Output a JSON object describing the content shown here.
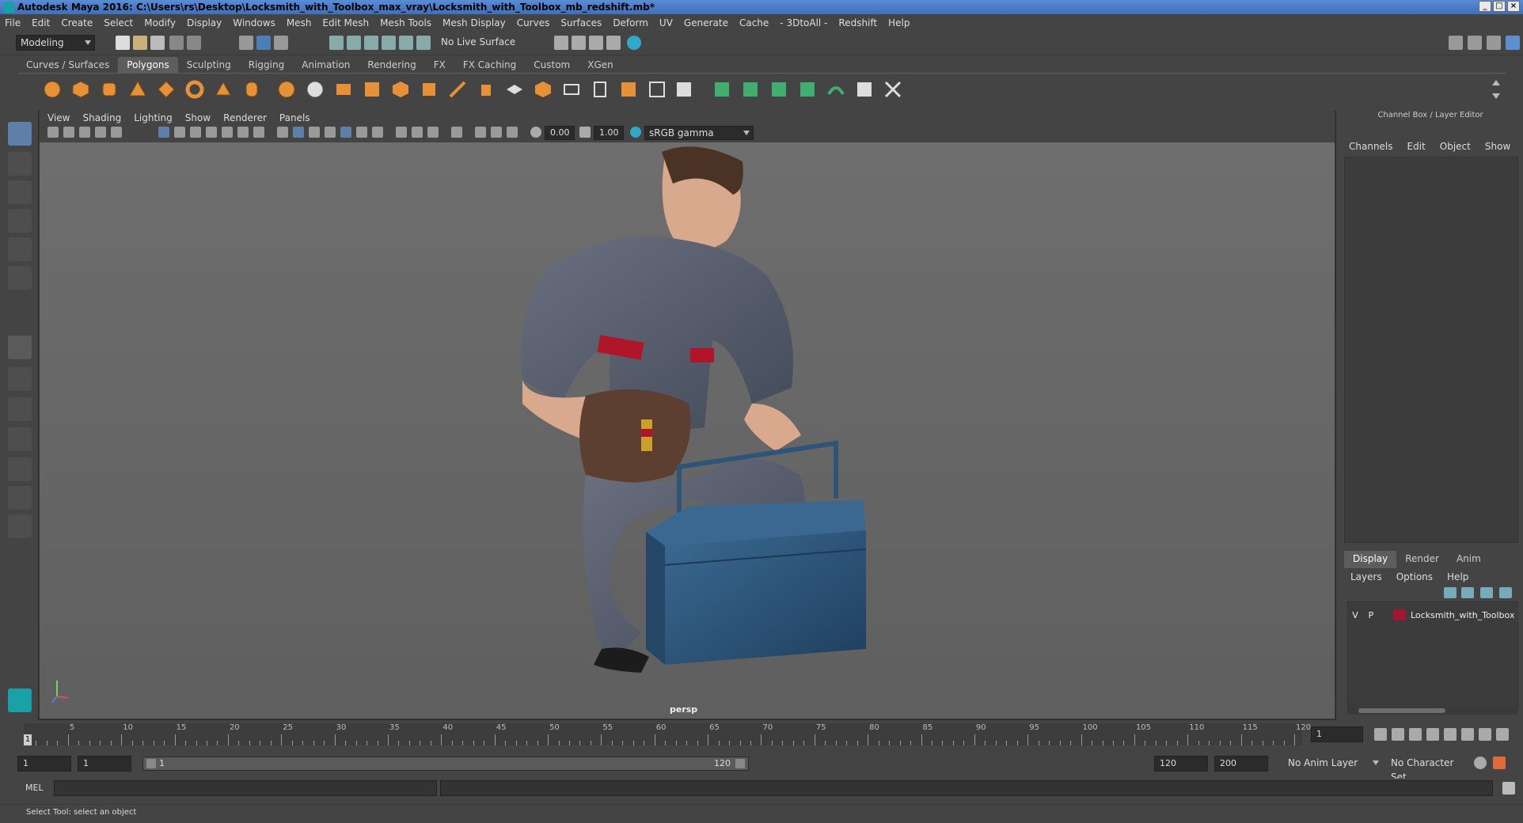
{
  "window": {
    "title": "Autodesk Maya 2016: C:\\Users\\rs\\Desktop\\Locksmith_with_Toolbox_max_vray\\Locksmith_with_Toolbox_mb_redshift.mb*",
    "buttons": [
      "_",
      "□",
      "×"
    ]
  },
  "menubar": [
    "File",
    "Edit",
    "Create",
    "Select",
    "Modify",
    "Display",
    "Windows",
    "Mesh",
    "Edit Mesh",
    "Mesh Tools",
    "Mesh Display",
    "Curves",
    "Surfaces",
    "Deform",
    "UV",
    "Generate",
    "Cache",
    "- 3DtoAll -",
    "Redshift",
    "Help"
  ],
  "toolbar": {
    "mode": "Modeling",
    "live_surface": "No Live Surface"
  },
  "shelf_tabs": {
    "items": [
      "Curves / Surfaces",
      "Polygons",
      "Sculpting",
      "Rigging",
      "Animation",
      "Rendering",
      "FX",
      "FX Caching",
      "Custom",
      "XGen"
    ],
    "active": "Polygons"
  },
  "viewport": {
    "menu": [
      "View",
      "Shading",
      "Lighting",
      "Show",
      "Renderer",
      "Panels"
    ],
    "exposure": "0.00",
    "gamma": "1.00",
    "color_space": "sRGB gamma",
    "camera_label": "persp"
  },
  "channel_box": {
    "title": "Channel Box / Layer Editor",
    "menu": [
      "Channels",
      "Edit",
      "Object",
      "Show"
    ]
  },
  "layer_editor": {
    "tabs": [
      "Display",
      "Render",
      "Anim"
    ],
    "active_tab": "Display",
    "menu": [
      "Layers",
      "Options",
      "Help"
    ],
    "layers": [
      {
        "v": "V",
        "p": "P",
        "name": "Locksmith_with_Toolbox",
        "color": "#a01630"
      }
    ]
  },
  "timeline": {
    "ticks": [
      "5",
      "10",
      "15",
      "20",
      "25",
      "30",
      "35",
      "40",
      "45",
      "50",
      "55",
      "60",
      "65",
      "70",
      "75",
      "80",
      "85",
      "90",
      "95",
      "100",
      "105",
      "110",
      "115",
      "120"
    ],
    "current_frame": "1",
    "frame_field": "1"
  },
  "range": {
    "start": "1",
    "start2": "1",
    "track_start": "1",
    "track_end": "120",
    "end": "120",
    "max": "200",
    "anim_layer": "No Anim Layer",
    "character_set": "No Character Set"
  },
  "command": {
    "lang": "MEL"
  },
  "help_line": "Select Tool: select an object",
  "colors": {
    "accent": "#5d5d5d",
    "viewport_bg": "#6a6a6a",
    "shelf_orange": "#e69138",
    "shelf_green": "#3fae6e"
  }
}
